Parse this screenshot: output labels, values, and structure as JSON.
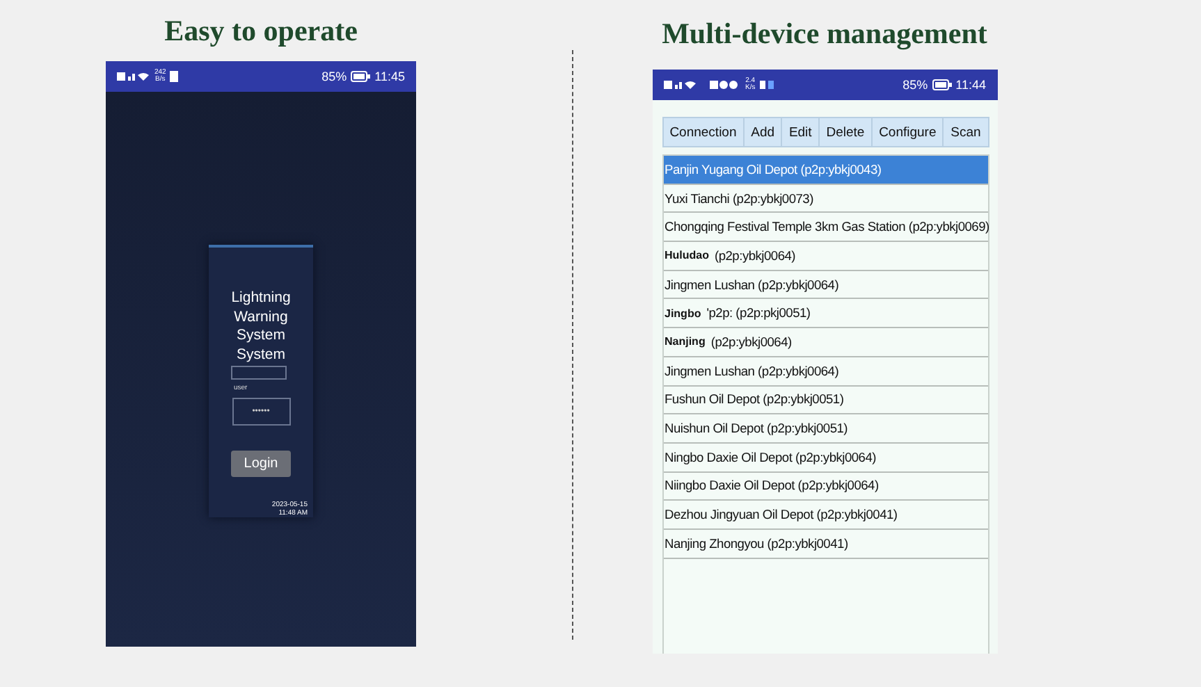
{
  "left": {
    "caption": "Easy to operate",
    "status_bar": {
      "speed_value": "242",
      "speed_unit": "B/s",
      "battery": "85%",
      "time": "11:45"
    },
    "login": {
      "title": "Lightning Warning System System",
      "user_label": "user",
      "password_value": "••••••",
      "button": "Login",
      "date": "2023-05-15",
      "time": "11:48 AM"
    }
  },
  "right": {
    "caption": "Multi-device management",
    "status_bar": {
      "speed_value": "2.4",
      "speed_unit": "K/s",
      "battery": "85%",
      "time": "11:44"
    },
    "toolbar": [
      "Connection",
      "Add",
      "Edit",
      "Delete",
      "Configure",
      "Scan"
    ],
    "devices": [
      {
        "text": "Panjin Yugang Oil Depot (p2p:ybkj0043)",
        "selected": true
      },
      {
        "text": "Yuxi Tianchi (p2p:ybkj0073)",
        "selected": false
      },
      {
        "text": "Chongqing Festival Temple 3km Gas Station (p2p:ybkj0069)",
        "selected": false
      },
      {
        "prefix": "Huludao",
        "text": "(p2p:ybkj0064)",
        "selected": false
      },
      {
        "text": "Jingmen Lushan (p2p:ybkj0064)",
        "selected": false
      },
      {
        "prefix": "Jingbo",
        "text": "'p2p: (p2p:pkj0051)",
        "selected": false
      },
      {
        "prefix": "Nanjing",
        "text": "(p2p:ybkj0064)",
        "selected": false
      },
      {
        "text": "Jingmen Lushan (p2p:ybkj0064)",
        "selected": false
      },
      {
        "text": "Fushun Oil Depot (p2p:ybkj0051)",
        "selected": false
      },
      {
        "text": "Nuishun Oil Depot (p2p:ybkj0051)",
        "selected": false
      },
      {
        "text": "Ningbo Daxie Oil Depot (p2p:ybkj0064)",
        "selected": false
      },
      {
        "text": "Niingbo Daxie Oil Depot (p2p:ybkj0064)",
        "selected": false
      },
      {
        "text": "Dezhou Jingyuan Oil Depot (p2p:ybkj0041)",
        "selected": false
      },
      {
        "text": "Nanjing Zhongyou (p2p:ybkj0041)",
        "selected": false
      }
    ]
  }
}
